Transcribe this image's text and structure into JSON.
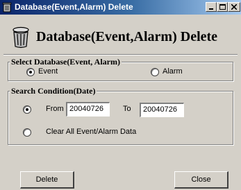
{
  "window": {
    "title": "Database(Event,Alarm) Delete",
    "title_buttons": {
      "minimize": "_",
      "maximize": "□",
      "close": "×"
    }
  },
  "header": {
    "title": "Database(Event,Alarm) Delete",
    "icon": "trash-can-icon"
  },
  "select_group": {
    "label": "Select Database(Event, Alarm)",
    "options": [
      {
        "label": "Event",
        "selected": true
      },
      {
        "label": "Alarm",
        "selected": false
      }
    ]
  },
  "search_group": {
    "label": "Search Condition(Date)",
    "from_label": "From",
    "from_value": "20040726",
    "to_label": "To",
    "to_value": "20040726",
    "date_selected": true,
    "clear_label": "Clear All Event/Alarm Data",
    "clear_selected": false
  },
  "buttons": {
    "delete": "Delete",
    "close": "Close"
  }
}
